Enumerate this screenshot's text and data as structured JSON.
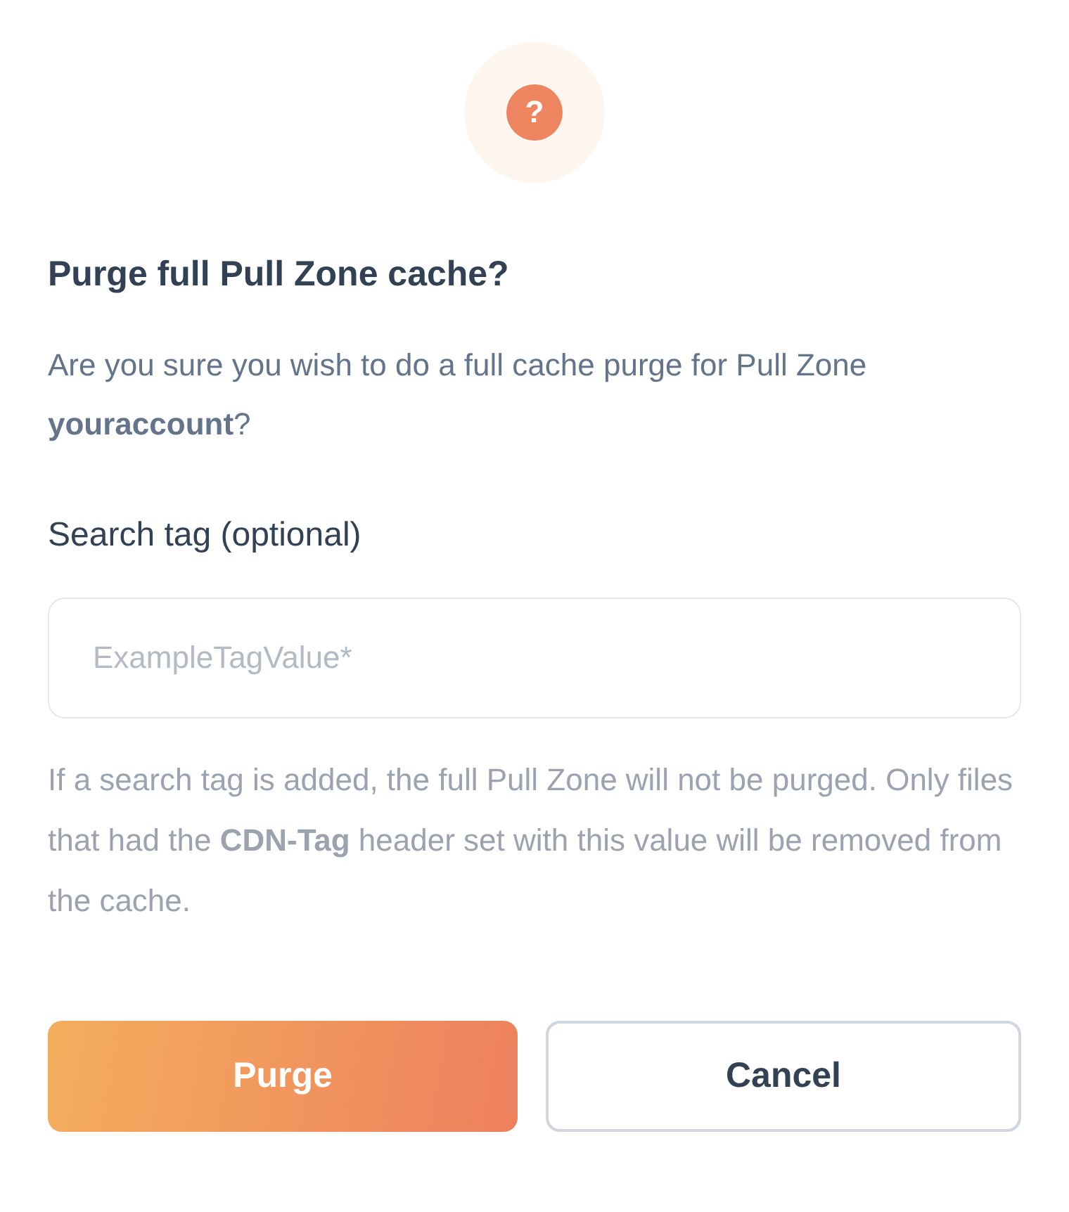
{
  "icon": {
    "glyph": "?"
  },
  "title": "Purge full Pull Zone cache?",
  "message": "Are you sure you wish to do a full cache purge for Pull Zone **youraccount**?",
  "search_tag": {
    "label": "Search tag (optional)",
    "placeholder": "ExampleTagValue*",
    "help": "If a search tag is added, the full Pull Zone will not be purged. Only files that had the **CDN-Tag** header set with this value will be removed from the cache."
  },
  "buttons": [
    {
      "label": "Purge",
      "kind": "primary"
    },
    {
      "label": "Cancel",
      "kind": "secondary"
    }
  ]
}
